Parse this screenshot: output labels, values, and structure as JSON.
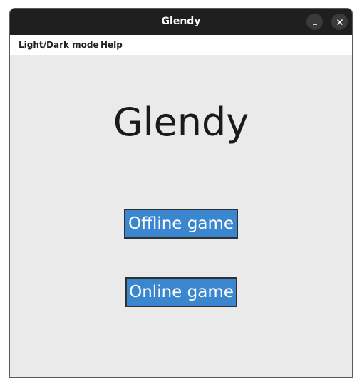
{
  "window": {
    "title": "Glendy",
    "minimize_icon": "minimize-icon",
    "close_icon": "close-icon"
  },
  "menubar": {
    "items": [
      {
        "label": "Light/Dark mode"
      },
      {
        "label": "Help"
      }
    ]
  },
  "main": {
    "app_title": "Glendy",
    "offline_button_label": "Offline game",
    "online_button_label": "Online game"
  },
  "colors": {
    "titlebar": "#1f1f1f",
    "background": "#eaeaea",
    "button": "#3a87cf",
    "button_text": "#ffffff"
  }
}
